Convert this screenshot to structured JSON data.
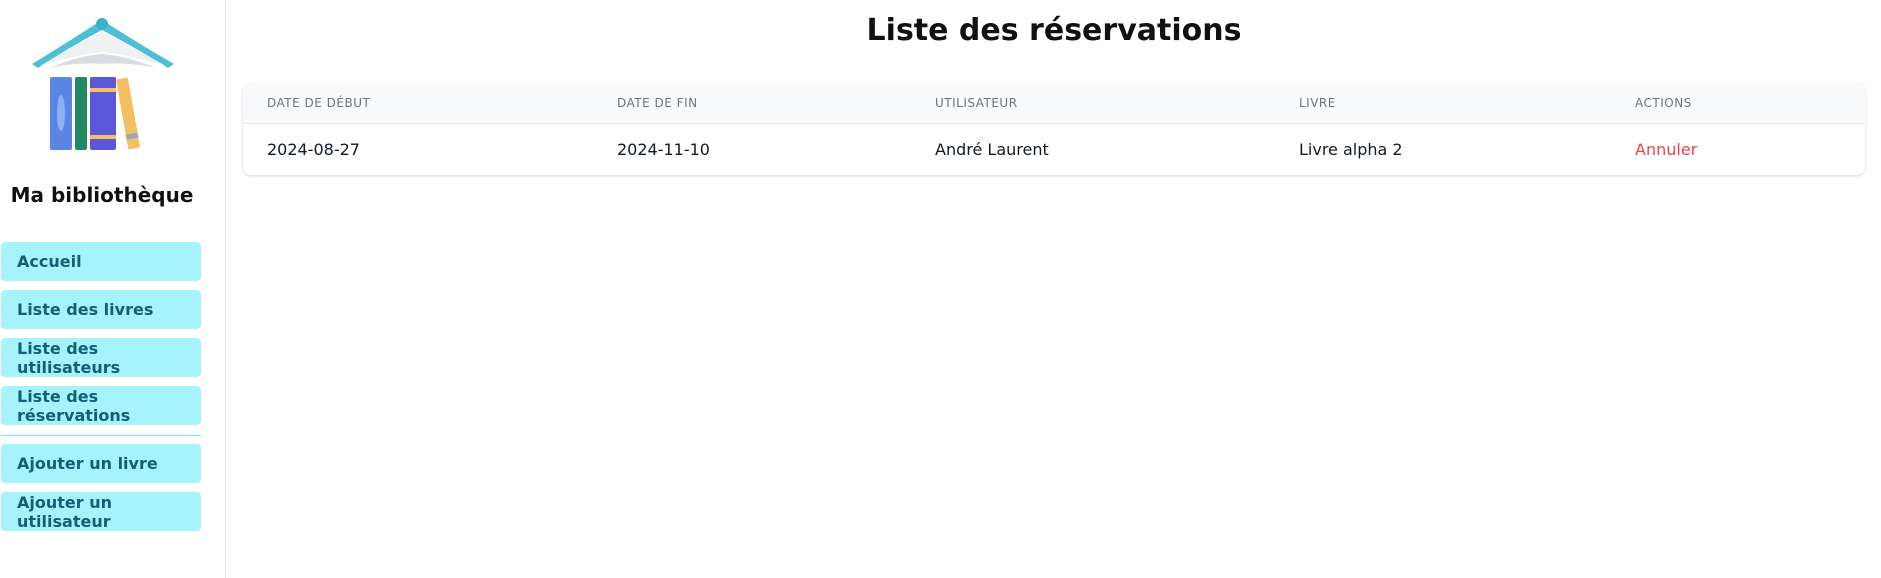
{
  "sidebar": {
    "brand": "Ma bibliothèque",
    "nav_primary": [
      {
        "label": "Accueil"
      },
      {
        "label": "Liste des livres"
      },
      {
        "label": "Liste des utilisateurs"
      },
      {
        "label": "Liste des réservations"
      }
    ],
    "nav_secondary": [
      {
        "label": "Ajouter un livre"
      },
      {
        "label": "Ajouter un utilisateur"
      }
    ]
  },
  "main": {
    "title": "Liste des réservations",
    "table": {
      "columns": [
        "Date de début",
        "Date de fin",
        "Utilisateur",
        "Livre",
        "Actions"
      ],
      "rows": [
        {
          "start": "2024-08-27",
          "end": "2024-11-10",
          "user": "André Laurent",
          "book": "Livre alpha 2",
          "action": "Annuler"
        }
      ]
    }
  },
  "colors": {
    "nav_bg": "#a5f3fc",
    "nav_text": "#155e75",
    "action_danger": "#ef4444",
    "table_header_bg": "#f9fafb"
  }
}
